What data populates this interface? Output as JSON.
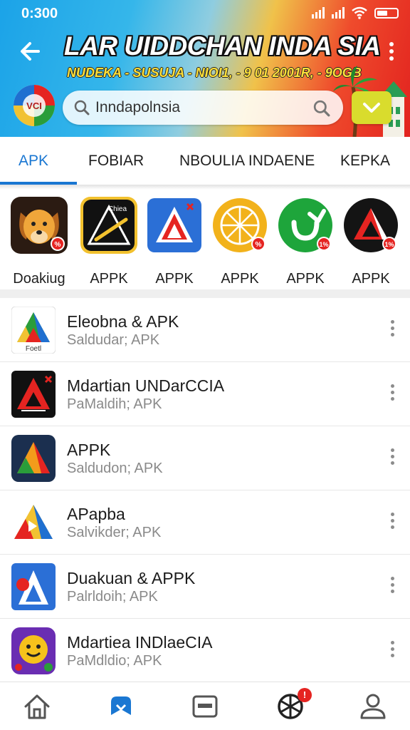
{
  "status_bar": {
    "time": "0:300"
  },
  "header": {
    "title": "LAR UIDDCHAN INDA SIA",
    "subtitle": "NUDEKA - SUSUJA - NIOI1, - 9 01 2001R, - 9OGB",
    "logo_text": "VCI"
  },
  "search": {
    "value": "Inndapolnsia"
  },
  "tabs": [
    {
      "label": "APK",
      "active": true
    },
    {
      "label": "FOBIAR",
      "active": false
    },
    {
      "label": "NBOULIA INDAENE",
      "active": false
    },
    {
      "label": "KEPKA",
      "active": false
    }
  ],
  "featured": [
    {
      "label": "Doakiug",
      "icon": "dog-app-icon",
      "badge": "%"
    },
    {
      "label": "APPK",
      "icon": "tent-app-icon",
      "badge": "",
      "icon_text": "Chiea"
    },
    {
      "label": "APPK",
      "icon": "triangle-app-icon",
      "badge": ""
    },
    {
      "label": "APPK",
      "icon": "globe-app-icon",
      "badge": "%"
    },
    {
      "label": "APPK",
      "icon": "refresh-app-icon",
      "badge": "1%"
    },
    {
      "label": "APPK",
      "icon": "red-triangle-app-icon",
      "badge": "1%"
    }
  ],
  "apps": [
    {
      "title": "Eleobna & APK",
      "subtitle": "Saldudar; APK",
      "icon": "colorful-triangle-icon",
      "icon_text": "Foetl"
    },
    {
      "title": "Mdartian UNDarCCIA",
      "subtitle": "PaMaldih; APK",
      "icon": "red-triangle-icon"
    },
    {
      "title": "APPK",
      "subtitle": "Saldudon; APK",
      "icon": "orange-triangle-icon"
    },
    {
      "title": "APapba",
      "subtitle": "Salvikder; APK",
      "icon": "play-triangle-icon"
    },
    {
      "title": "Duakuan & APPK",
      "subtitle": "Palrldoih; APK",
      "icon": "white-triangle-icon"
    },
    {
      "title": "Mdartiea INDlaeCIA",
      "subtitle": "PaMdldio; APK",
      "icon": "smiley-game-icon"
    }
  ],
  "bottom_nav": {
    "items": [
      "home-icon",
      "apps-icon",
      "library-icon",
      "games-icon",
      "profile-icon"
    ],
    "badge": "!"
  },
  "colors": {
    "accent": "#1a77d2",
    "header_blue": "#1ba3e8",
    "header_red": "#e2231f",
    "badge_red": "#e52421"
  }
}
